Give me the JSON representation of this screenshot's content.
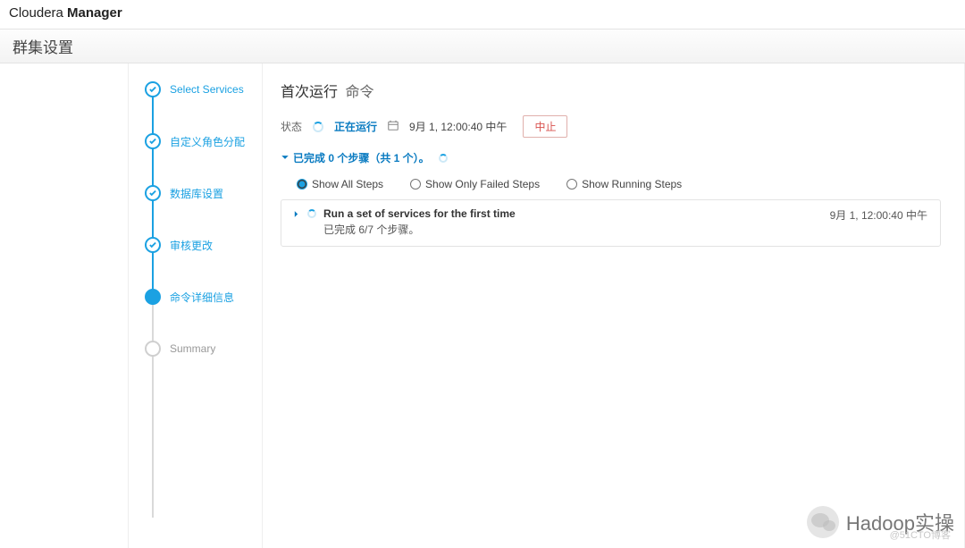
{
  "brand": {
    "part1": "Cloudera",
    "part2": "Manager"
  },
  "page_title": "群集设置",
  "steps": [
    {
      "label": "Select Services",
      "state": "done"
    },
    {
      "label": "自定义角色分配",
      "state": "done"
    },
    {
      "label": "数据库设置",
      "state": "done"
    },
    {
      "label": "审核更改",
      "state": "done"
    },
    {
      "label": "命令详细信息",
      "state": "active"
    },
    {
      "label": "Summary",
      "state": "pending"
    }
  ],
  "main": {
    "heading": "首次运行",
    "heading_suffix": "命令",
    "status_label": "状态",
    "status_value": "正在运行",
    "calendar_text": "9月 1, 12:00:40 中午",
    "abort_label": "中止",
    "progress_text": "已完成 0 个步骤（共 1 个）。"
  },
  "filters": {
    "show_all": "Show All Steps",
    "show_failed": "Show Only Failed Steps",
    "show_running": "Show Running Steps",
    "selected": "show_all"
  },
  "card": {
    "title": "Run a set of services for the first time",
    "subtitle": "已完成  6/7  个步骤。",
    "timestamp": "9月 1, 12:00:40 中午"
  },
  "watermark": "Hadoop实操",
  "watermark_credit": "@51CTO博客"
}
